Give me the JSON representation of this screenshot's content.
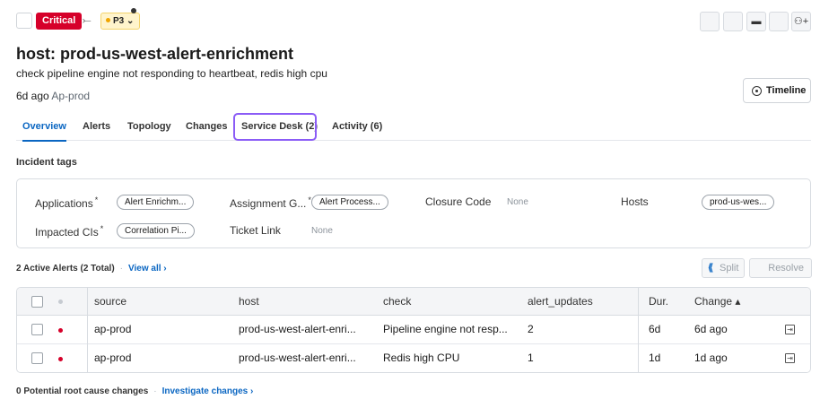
{
  "header": {
    "severity": "Critical",
    "route_icon": "route-icon",
    "route_glyph": "⤚",
    "priority": "P3",
    "priority_caret": "⌄",
    "toolbar_icons": [
      "blank-square-icon",
      "blank-square-icon",
      "comment-icon",
      "blank-square-icon",
      "add-user-icon"
    ],
    "comment_glyph": "▬",
    "add_user_glyph": "⚇+"
  },
  "incident": {
    "title": "host: prod-us-west-alert-enrichment",
    "description": "check pipeline engine not responding to heartbeat, redis high cpu",
    "age": "6d ago",
    "source": "Ap-prod",
    "timeline_label": "Timeline"
  },
  "tabs": [
    "Overview",
    "Alerts",
    "Topology",
    "Changes",
    "Service Desk (2)",
    "Activity (6)"
  ],
  "active_tab": "Overview",
  "incident_tags": {
    "label": "Incident tags",
    "fields": {
      "applications": {
        "label": "Applications",
        "required": "*",
        "value": "Alert Enrichm..."
      },
      "assignment_group": {
        "label": "Assignment G...",
        "required": "*",
        "value": "Alert Process..."
      },
      "closure_code": {
        "label": "Closure Code",
        "value": "None"
      },
      "hosts": {
        "label": "Hosts",
        "value": "prod-us-wes..."
      },
      "impacted_cis": {
        "label": "Impacted CIs",
        "required": "*",
        "value": "Correlation Pi..."
      },
      "ticket_link": {
        "label": "Ticket Link",
        "value": "None"
      }
    }
  },
  "alerts": {
    "summary": "2 Active Alerts (2 Total)",
    "separator": "·",
    "view_all": "View all ›",
    "split_label": "Split",
    "split_glyph": "⟪",
    "resolve_label": "Resolve",
    "columns": [
      "source",
      "host",
      "check",
      "alert_updates",
      "Dur.",
      "Change ▴"
    ],
    "rows": [
      {
        "source": "ap-prod",
        "host": "prod-us-west-alert-enri...",
        "check": "Pipeline engine not resp...",
        "alert_updates": "2",
        "duration": "6d",
        "change": "6d ago"
      },
      {
        "source": "ap-prod",
        "host": "prod-us-west-alert-enri...",
        "check": "Redis high CPU",
        "alert_updates": "1",
        "duration": "1d",
        "change": "1d ago"
      }
    ],
    "open_glyph": "⇥"
  },
  "root_cause": {
    "summary": "0 Potential root cause changes",
    "separator": "·",
    "link": "Investigate changes ›"
  },
  "colors": {
    "critical": "#d6002a",
    "accent": "#0a66c2",
    "focus_ring": "#8b5cf6",
    "priority_bg": "#fff4cc"
  }
}
